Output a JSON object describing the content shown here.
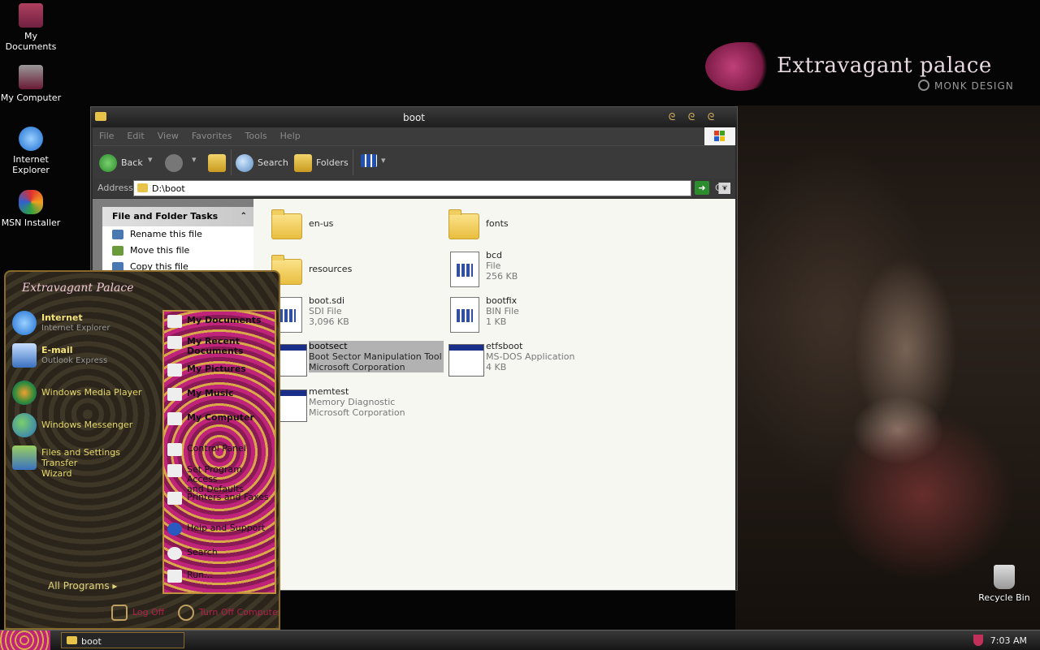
{
  "desktop": {
    "icons": [
      {
        "label": "My Documents",
        "icon": "my-documents-icon"
      },
      {
        "label": "My Computer",
        "icon": "my-computer-icon"
      },
      {
        "label1": "Internet",
        "label2": "Explorer",
        "icon": "internet-explorer-icon"
      },
      {
        "label": "MSN Installer",
        "icon": "msn-butterfly-icon"
      },
      {
        "label": "Recycle Bin",
        "icon": "recycle-bin-icon"
      }
    ],
    "brand": {
      "title": "Extravagant palace",
      "subtitle": "MONK DESIGN"
    }
  },
  "window": {
    "title": "boot",
    "menu": [
      "File",
      "Edit",
      "View",
      "Favorites",
      "Tools",
      "Help"
    ],
    "toolbar": {
      "back": "Back",
      "search": "Search",
      "folders": "Folders"
    },
    "address": {
      "label": "Address",
      "value": "D:\\boot",
      "go": "Go"
    },
    "tasks": {
      "header": "File and Folder Tasks",
      "items": [
        "Rename this file",
        "Move this file",
        "Copy this file"
      ]
    },
    "files": [
      {
        "name": "en-us",
        "kind": "folder"
      },
      {
        "name": "fonts",
        "kind": "folder"
      },
      {
        "name": "resources",
        "kind": "folder"
      },
      {
        "name": "bcd",
        "type": "File",
        "size": "256 KB",
        "kind": "doc"
      },
      {
        "name": "boot.sdi",
        "type": "SDI File",
        "size": "3,096 KB",
        "kind": "doc"
      },
      {
        "name": "bootfix",
        "type": "BIN File",
        "size": "1 KB",
        "kind": "doc"
      },
      {
        "name": "bootsect",
        "type": "Boot Sector Manipulation Tool",
        "size": "Microsoft Corporation",
        "kind": "app",
        "selected": true
      },
      {
        "name": "etfsboot",
        "type": "MS-DOS Application",
        "size": "4 KB",
        "kind": "app"
      },
      {
        "name": "memtest",
        "type": "Memory Diagnostic",
        "size": "Microsoft Corporation",
        "kind": "app"
      }
    ]
  },
  "start_menu": {
    "header": "Extravagant Palace",
    "left": [
      {
        "title": "Internet",
        "sub": "Internet Explorer"
      },
      {
        "title": "E-mail",
        "sub": "Outlook Express"
      },
      {
        "title": "Windows Media Player"
      },
      {
        "title": "Windows Messenger"
      },
      {
        "title1": "Files and Settings Transfer",
        "title2": "Wizard"
      }
    ],
    "all_programs": "All Programs",
    "right": [
      {
        "label": "My Documents"
      },
      {
        "label1": "My Recent",
        "label2": "Documents"
      },
      {
        "label": "My Pictures"
      },
      {
        "label": "My Music"
      },
      {
        "label": "My Computer"
      },
      {
        "label": "Control Panel"
      },
      {
        "label1": "Set Program Access",
        "label2": "and Defaults"
      },
      {
        "label": "Printers and Faxes"
      },
      {
        "label": "Help and Support"
      },
      {
        "label": "Search"
      },
      {
        "label": "Run..."
      }
    ],
    "log_off": "Log Off",
    "turn_off": "Turn Off Computer"
  },
  "taskbar": {
    "task": "boot",
    "clock": "7:03 AM"
  }
}
